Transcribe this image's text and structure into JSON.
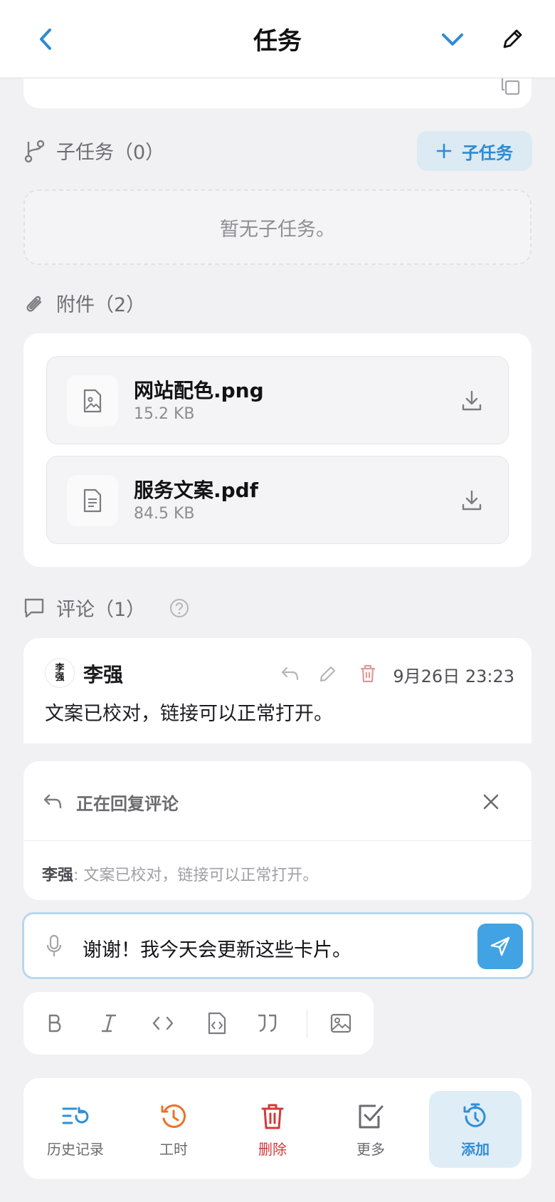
{
  "header": {
    "title": "任务"
  },
  "subtasks": {
    "title": "子任务（0）",
    "add_label": "子任务",
    "empty_text": "暂无子任务。"
  },
  "attachments": {
    "title": "附件（2）",
    "files": [
      {
        "name": "网站配色.png",
        "size": "15.2 KB",
        "icon": "image-file-icon"
      },
      {
        "name": "服务文案.pdf",
        "size": "84.5 KB",
        "icon": "document-file-icon"
      }
    ]
  },
  "comments": {
    "title": "评论（1）",
    "items": [
      {
        "author": "李强",
        "avatar_text": "李强",
        "time": "9月26日 23:23",
        "text": "文案已校对，链接可以正常打开。"
      }
    ]
  },
  "reply": {
    "label": "正在回复评论",
    "quote_author": "李强",
    "quote_text": ": 文案已校对，链接可以正常打开。"
  },
  "input": {
    "value": "谢谢！我今天会更新这些卡片。"
  },
  "toolbar": [
    "bold-icon",
    "italic-icon",
    "code-icon",
    "code-block-icon",
    "quote-icon",
    "image-icon"
  ],
  "bottom_tabs": [
    {
      "label": "历史记录",
      "icon": "history-list-icon",
      "color": "#2f8fd6"
    },
    {
      "label": "工时",
      "icon": "clock-history-icon",
      "color": "#e8732a"
    },
    {
      "label": "删除",
      "icon": "trash-icon",
      "color": "#d23a3a"
    },
    {
      "label": "更多",
      "icon": "checkbox-icon",
      "color": "#6b6b70"
    },
    {
      "label": "添加",
      "icon": "timer-add-icon",
      "color": "#2f8fd6"
    }
  ]
}
